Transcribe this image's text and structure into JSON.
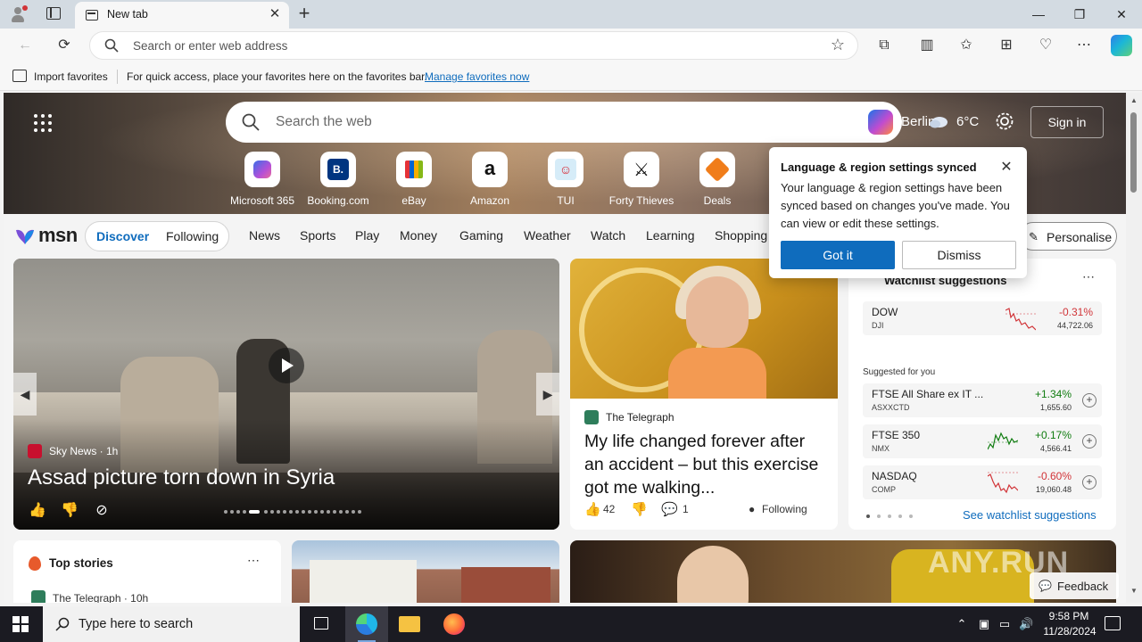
{
  "browser": {
    "tab_title": "New tab",
    "address_placeholder": "Search or enter web address",
    "window_controls": {
      "minimize": "—",
      "maximize": "❐",
      "close": "✕"
    }
  },
  "favorites_bar": {
    "import_label": "Import favorites",
    "message": "For quick access, place your favorites here on the favorites bar.",
    "link": "Manage favorites now"
  },
  "hero": {
    "search_placeholder": "Search the web",
    "location": "Berlin",
    "temperature": "6°C",
    "sign_in": "Sign in"
  },
  "quick_links": [
    {
      "label": "Microsoft 365",
      "icon": "microsoft365-icon"
    },
    {
      "label": "Booking.com",
      "icon": "booking-icon"
    },
    {
      "label": "eBay",
      "icon": "ebay-icon"
    },
    {
      "label": "Amazon",
      "icon": "amazon-icon"
    },
    {
      "label": "TUI",
      "icon": "tui-icon"
    },
    {
      "label": "Forty Thieves",
      "icon": "forty-thieves-icon"
    },
    {
      "label": "Deals",
      "icon": "deals-icon"
    }
  ],
  "nav": {
    "logo": "msn",
    "discover": "Discover",
    "following": "Following",
    "items": [
      "News",
      "Sports",
      "Play",
      "Money",
      "Gaming",
      "Weather",
      "Watch",
      "Learning",
      "Shopping"
    ],
    "personalise": "Personalise"
  },
  "main_story": {
    "source": "Sky News · 1h",
    "headline": "Assad picture torn down in Syria"
  },
  "telegraph_story": {
    "source": "The Telegraph",
    "headline": "My life changed forever after an accident – but this exercise got me walking...",
    "likes": "42",
    "comments": "1",
    "following": "Following"
  },
  "watchlist": {
    "title": "Watchlist suggestions",
    "suggested_label": "Suggested for you",
    "link": "See watchlist suggestions",
    "stocks": [
      {
        "name": "DOW",
        "symbol": "DJI",
        "change": "-0.31%",
        "price": "44,722.06",
        "color": "#d13438"
      },
      {
        "name": "FTSE All Share ex IT ...",
        "symbol": "ASXXCTD",
        "change": "+1.34%",
        "price": "1,655.60",
        "color": "#107c10"
      },
      {
        "name": "FTSE 350",
        "symbol": "NMX",
        "change": "+0.17%",
        "price": "4,566.41",
        "color": "#107c10"
      },
      {
        "name": "NASDAQ",
        "symbol": "COMP",
        "change": "-0.60%",
        "price": "19,060.48",
        "color": "#d13438"
      }
    ]
  },
  "top_stories": {
    "title": "Top stories",
    "source": "The Telegraph · 10h"
  },
  "popup": {
    "title": "Language & region settings synced",
    "body": "Your language & region settings have been synced based on changes you've made. You can view or edit these settings.",
    "primary": "Got it",
    "secondary": "Dismiss"
  },
  "feedback": "Feedback",
  "watermark": "ANY.RUN",
  "taskbar": {
    "search_placeholder": "Type here to search",
    "time": "9:58 PM",
    "date": "11/28/2024"
  },
  "colors": {
    "accent": "#0f6cbd",
    "negative": "#d13438",
    "positive": "#107c10"
  }
}
